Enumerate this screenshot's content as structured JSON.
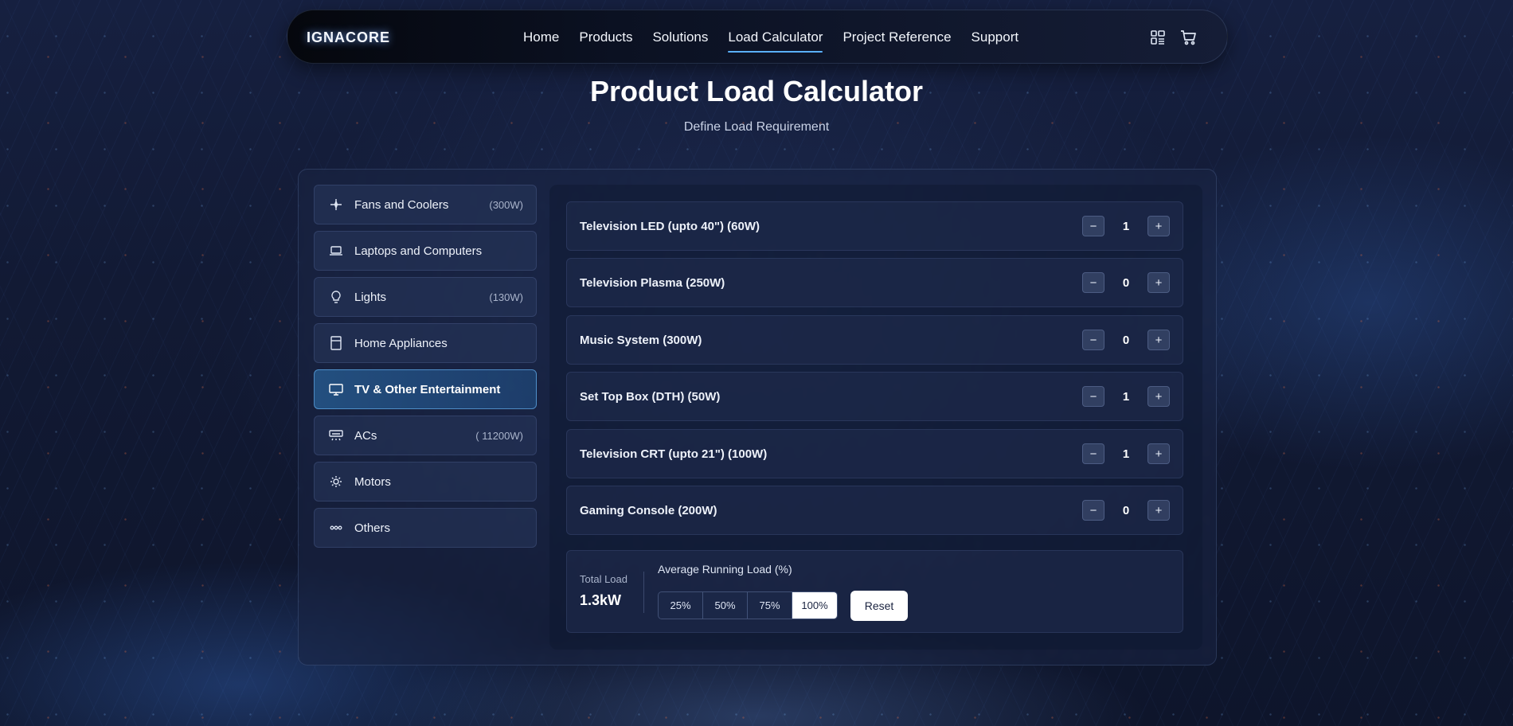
{
  "brand": {
    "logo_text": "IGNACORE"
  },
  "nav": {
    "links": [
      "Home",
      "Products",
      "Solutions",
      "Load Calculator",
      "Project Reference",
      "Support"
    ],
    "active": "Load Calculator",
    "icons": [
      "grid-icon",
      "cart-icon"
    ]
  },
  "page": {
    "title": "Product Load Calculator",
    "subtitle": "Define Load Requirement"
  },
  "categories": [
    {
      "label": "Fans and Coolers",
      "watts": "(300W)",
      "icon": "sparkle-icon"
    },
    {
      "label": "Laptops and Computers",
      "watts": "",
      "icon": "laptop-icon"
    },
    {
      "label": "Lights",
      "watts": "(130W)",
      "icon": "bulb-icon"
    },
    {
      "label": "Home Appliances",
      "watts": "",
      "icon": "appliance-icon"
    },
    {
      "label": "TV & Other Entertainment",
      "watts": "",
      "icon": "tv-icon",
      "active": true
    },
    {
      "label": "ACs",
      "watts": "( 11200W)",
      "icon": "ac-icon"
    },
    {
      "label": "Motors",
      "watts": "",
      "icon": "motor-icon"
    },
    {
      "label": "Others",
      "watts": "",
      "icon": "dots-icon"
    }
  ],
  "items": [
    {
      "label": "Television LED (upto 40\") (60W)",
      "qty": "1"
    },
    {
      "label": "Television Plasma (250W)",
      "qty": "0"
    },
    {
      "label": "Music System (300W)",
      "qty": "0"
    },
    {
      "label": "Set Top Box (DTH) (50W)",
      "qty": "1"
    },
    {
      "label": "Television CRT (upto 21\") (100W)",
      "qty": "1"
    },
    {
      "label": "Gaming Console (200W)",
      "qty": "0"
    }
  ],
  "stepper": {
    "minus": "−",
    "plus": "+"
  },
  "summary": {
    "total_label": "Total Load",
    "total_value": "1.3kW",
    "avg_label": "Average Running Load (%)",
    "options": [
      "25%",
      "50%",
      "75%",
      "100%"
    ],
    "selected": "100%",
    "reset_label": "Reset"
  },
  "colors": {
    "accent": "#5ab0ff",
    "active_cat_border": "#6ebeff"
  }
}
